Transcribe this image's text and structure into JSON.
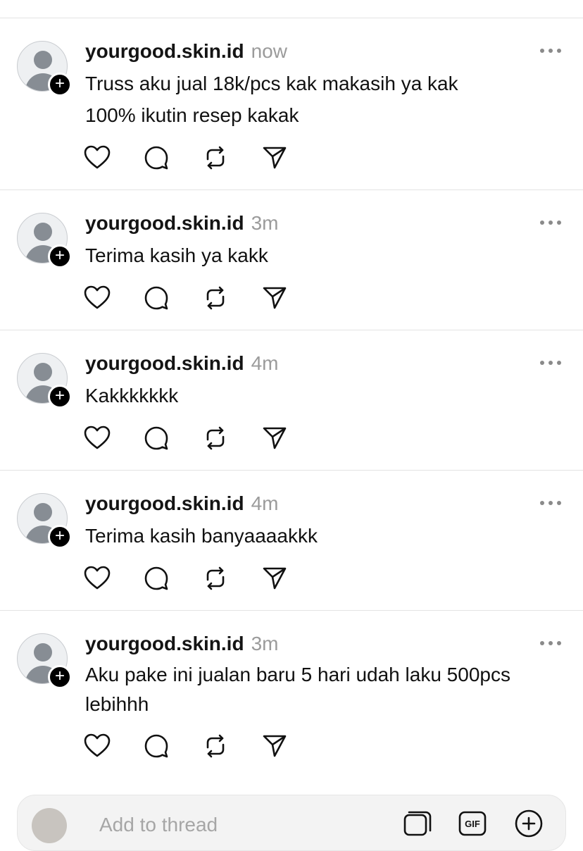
{
  "posts": [
    {
      "username": "yourgood.skin.id",
      "time": "now",
      "lines": [
        "Truss aku jual 18k/pcs kak makasih ya kak",
        "100% ikutin resep kakak"
      ]
    },
    {
      "username": "yourgood.skin.id",
      "time": "3m",
      "lines": [
        "Terima kasih ya kakk"
      ]
    },
    {
      "username": "yourgood.skin.id",
      "time": "4m",
      "lines": [
        "Kakkkkkkk"
      ]
    },
    {
      "username": "yourgood.skin.id",
      "time": "4m",
      "lines": [
        "Terima kasih banyaaaakkk"
      ]
    },
    {
      "username": "yourgood.skin.id",
      "time": "3m",
      "lines": [
        "Aku pake ini jualan baru 5 hari udah laku 500pcs",
        "lebihhh"
      ]
    }
  ],
  "composer": {
    "placeholder": "Add to thread",
    "gif_label": "GIF"
  },
  "icons": {
    "like": "heart-icon",
    "comment": "comment-icon",
    "repost": "repost-icon",
    "share": "send-icon",
    "more": "more-icon",
    "follow": "plus-icon"
  },
  "colors": {
    "username": "#141414",
    "timestamp": "#9b9b9b",
    "divider": "#e3e3e3",
    "avatar_glyph": "#878d94"
  }
}
